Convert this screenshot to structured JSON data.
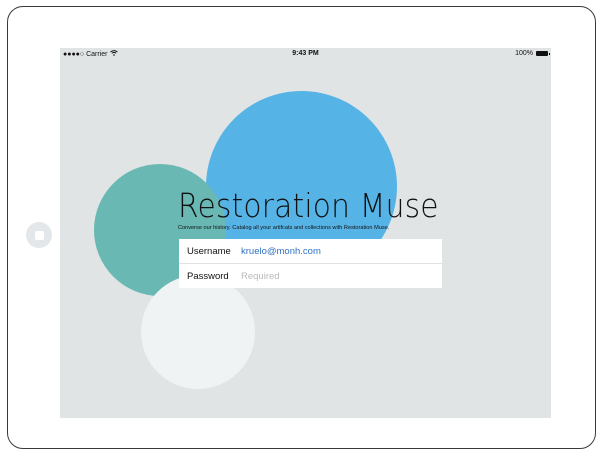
{
  "status_bar": {
    "carrier": "●●●●○ Carrier",
    "wifi_icon": "wifi-icon",
    "time": "9:43 PM",
    "battery": "100%",
    "battery_icon": "battery-icon"
  },
  "app": {
    "title": "Restoration Muse",
    "subtitle": "Converse our history. Catalog all your artifcats and collections with Restoration Muse."
  },
  "login": {
    "username_label": "Username",
    "username_value": "kruelo@monh.com",
    "password_label": "Password",
    "password_placeholder": "Required"
  },
  "colors": {
    "background": "#e1e4e5",
    "circle_blue": "#56b3e6",
    "circle_teal": "#69b8b3",
    "circle_white": "#f0f3f3",
    "accent_text": "#2f72c4"
  }
}
